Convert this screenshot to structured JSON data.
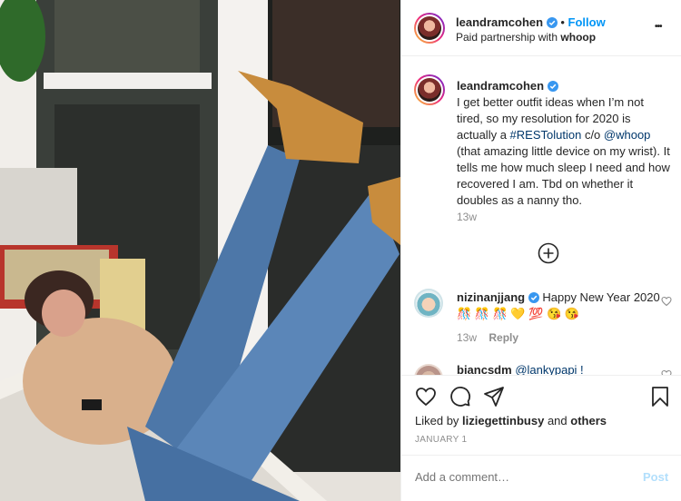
{
  "header": {
    "username": "leandramcohen",
    "dot": "•",
    "follow_label": "Follow",
    "subtitle_prefix": "Paid partnership with ",
    "subtitle_partner": "whoop",
    "more_label": "•••"
  },
  "caption": {
    "username": "leandramcohen",
    "text_1": "I get better outfit ideas when I’m not tired, so my resolution for 2020 is actually a ",
    "hashtag": "#RESTolution",
    "text_2": " c/o ",
    "mention": "@whoop",
    "text_3": " (that amazing little device on my wrist). It tells me how much sleep I need and how recovered I am. Tbd on whether it doubles as a nanny tho.",
    "time": "13w"
  },
  "load_more_icon": "plus-circle-icon",
  "comments": [
    {
      "username": "nizinanjjang",
      "text": " Happy New Year 2020 🎊 🎊 🎊 💛 💯 😘 😘",
      "time": "13w",
      "reply_label": "Reply"
    },
    {
      "username": "biancsdm",
      "text": "@lankypapi !"
    }
  ],
  "actions": {
    "like_icon": "heart-icon",
    "comment_icon": "comment-icon",
    "share_icon": "paper-plane-icon",
    "save_icon": "bookmark-icon"
  },
  "likes": {
    "prefix": "Liked by ",
    "user": "liziegettinbusy",
    "middle": " and ",
    "others": "others"
  },
  "date": "JANUARY 1",
  "comment_box": {
    "placeholder": "Add a comment…",
    "post_label": "Post"
  },
  "colors": {
    "accent": "#0095f6",
    "verified": "#3897f0",
    "text": "#262626",
    "muted": "#8e8e8e"
  }
}
